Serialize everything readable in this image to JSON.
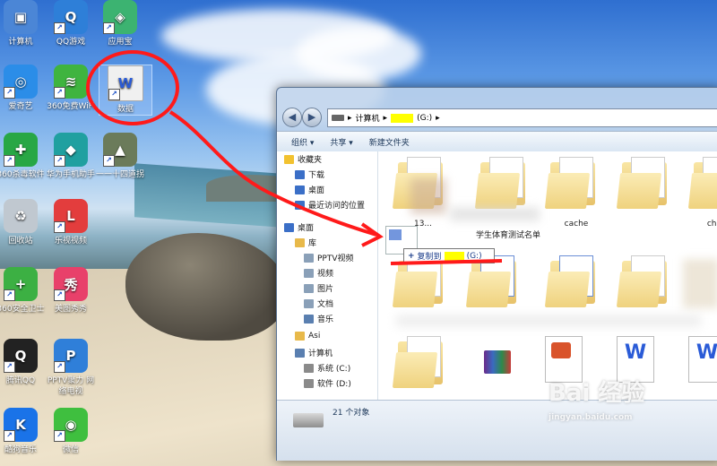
{
  "desktop": {
    "icons": [
      {
        "label": "计算机",
        "color": "#4b86d6",
        "glyph": "▣"
      },
      {
        "label": "QQ游戏",
        "color": "#2e7fd8",
        "glyph": "Q"
      },
      {
        "label": "应用宝",
        "color": "#3cb371",
        "glyph": "◈"
      },
      {
        "label": "爱奇艺",
        "color": "#2b8de8",
        "glyph": "◎"
      },
      {
        "label": "360免费WiFi",
        "color": "#3fb43f",
        "glyph": "≋"
      },
      {
        "label": "数据",
        "color": "#f0f0f0",
        "glyph": "W"
      },
      {
        "label": "360杀毒软件",
        "color": "#28a745",
        "glyph": "✚"
      },
      {
        "label": "华为手机助手",
        "color": "#20a0a0",
        "glyph": "◆"
      },
      {
        "label": "一一十四道拐",
        "color": "#6b7b5a",
        "glyph": "▲"
      },
      {
        "label": "回收站",
        "color": "#c0c8d0",
        "glyph": "♻"
      },
      {
        "label": "乐视视频",
        "color": "#e33d3d",
        "glyph": "L"
      },
      {
        "label": "360安全卫士",
        "color": "#3cb043",
        "glyph": "+"
      },
      {
        "label": "美图秀秀",
        "color": "#e8406a",
        "glyph": "秀"
      },
      {
        "label": "腾讯QQ",
        "color": "#222222",
        "glyph": "Q"
      },
      {
        "label": "PPTV聚力 网络电视",
        "color": "#2f7fd9",
        "glyph": "P"
      },
      {
        "label": "酷狗音乐",
        "color": "#1a73e8",
        "glyph": "K"
      },
      {
        "label": "微信",
        "color": "#3fbf3f",
        "glyph": "◉"
      }
    ]
  },
  "explorer": {
    "breadcrumb": {
      "computer": "计算机",
      "drive": "(G:)"
    },
    "toolbar": {
      "organize": "组织 ▾",
      "share": "共享 ▾",
      "new_folder": "新建文件夹"
    },
    "sidebar": [
      {
        "label": "收藏夹",
        "icon": "star-icon",
        "color": "#f2c230",
        "level": 0
      },
      {
        "label": "下载",
        "icon": "download-icon",
        "color": "#3b6fc7",
        "level": 1
      },
      {
        "label": "桌面",
        "icon": "desktop-icon",
        "color": "#3b6fc7",
        "level": 1
      },
      {
        "label": "最近访问的位置",
        "icon": "recent-icon",
        "color": "#3b6fc7",
        "level": 1
      },
      {
        "label": "桌面",
        "icon": "desktop-icon",
        "color": "#3b6fc7",
        "level": 0
      },
      {
        "label": "库",
        "icon": "library-icon",
        "color": "#e8b94a",
        "level": 1
      },
      {
        "label": "PPTV视频",
        "icon": "video-folder-icon",
        "color": "#8aa0b8",
        "level": 2
      },
      {
        "label": "视频",
        "icon": "video-folder-icon",
        "color": "#8aa0b8",
        "level": 2
      },
      {
        "label": "图片",
        "icon": "picture-folder-icon",
        "color": "#8aa0b8",
        "level": 2
      },
      {
        "label": "文档",
        "icon": "document-folder-icon",
        "color": "#8aa0b8",
        "level": 2
      },
      {
        "label": "音乐",
        "icon": "music-icon",
        "color": "#5a7fb0",
        "level": 2
      },
      {
        "label": "Asi",
        "icon": "user-folder-icon",
        "color": "#e8b94a",
        "level": 1
      },
      {
        "label": "计算机",
        "icon": "computer-icon",
        "color": "#5a7fb0",
        "level": 1
      },
      {
        "label": "系统 (C:)",
        "icon": "drive-icon",
        "color": "#8a8a8a",
        "level": 2
      },
      {
        "label": "软件 (D:)",
        "icon": "drive-icon",
        "color": "#8a8a8a",
        "level": 2
      }
    ],
    "files": [
      {
        "label": "",
        "kind": "folder"
      },
      {
        "label": "",
        "kind": "folder"
      },
      {
        "label": "",
        "kind": "folder"
      },
      {
        "label": "",
        "kind": "folder"
      },
      {
        "label": "",
        "kind": "folder"
      },
      {
        "label": "13...",
        "kind": "label"
      },
      {
        "label": "学生体育测试名单",
        "kind": "label"
      },
      {
        "label": "cache",
        "kind": "label"
      },
      {
        "label": "chu",
        "kind": "label"
      }
    ],
    "status": {
      "count": "21 个对象"
    }
  },
  "drag_tooltip": {
    "text": "复制到",
    "drive": "(G:)"
  },
  "watermark": {
    "brand": "Bai 经验",
    "url": "jingyan.baidu.com"
  }
}
